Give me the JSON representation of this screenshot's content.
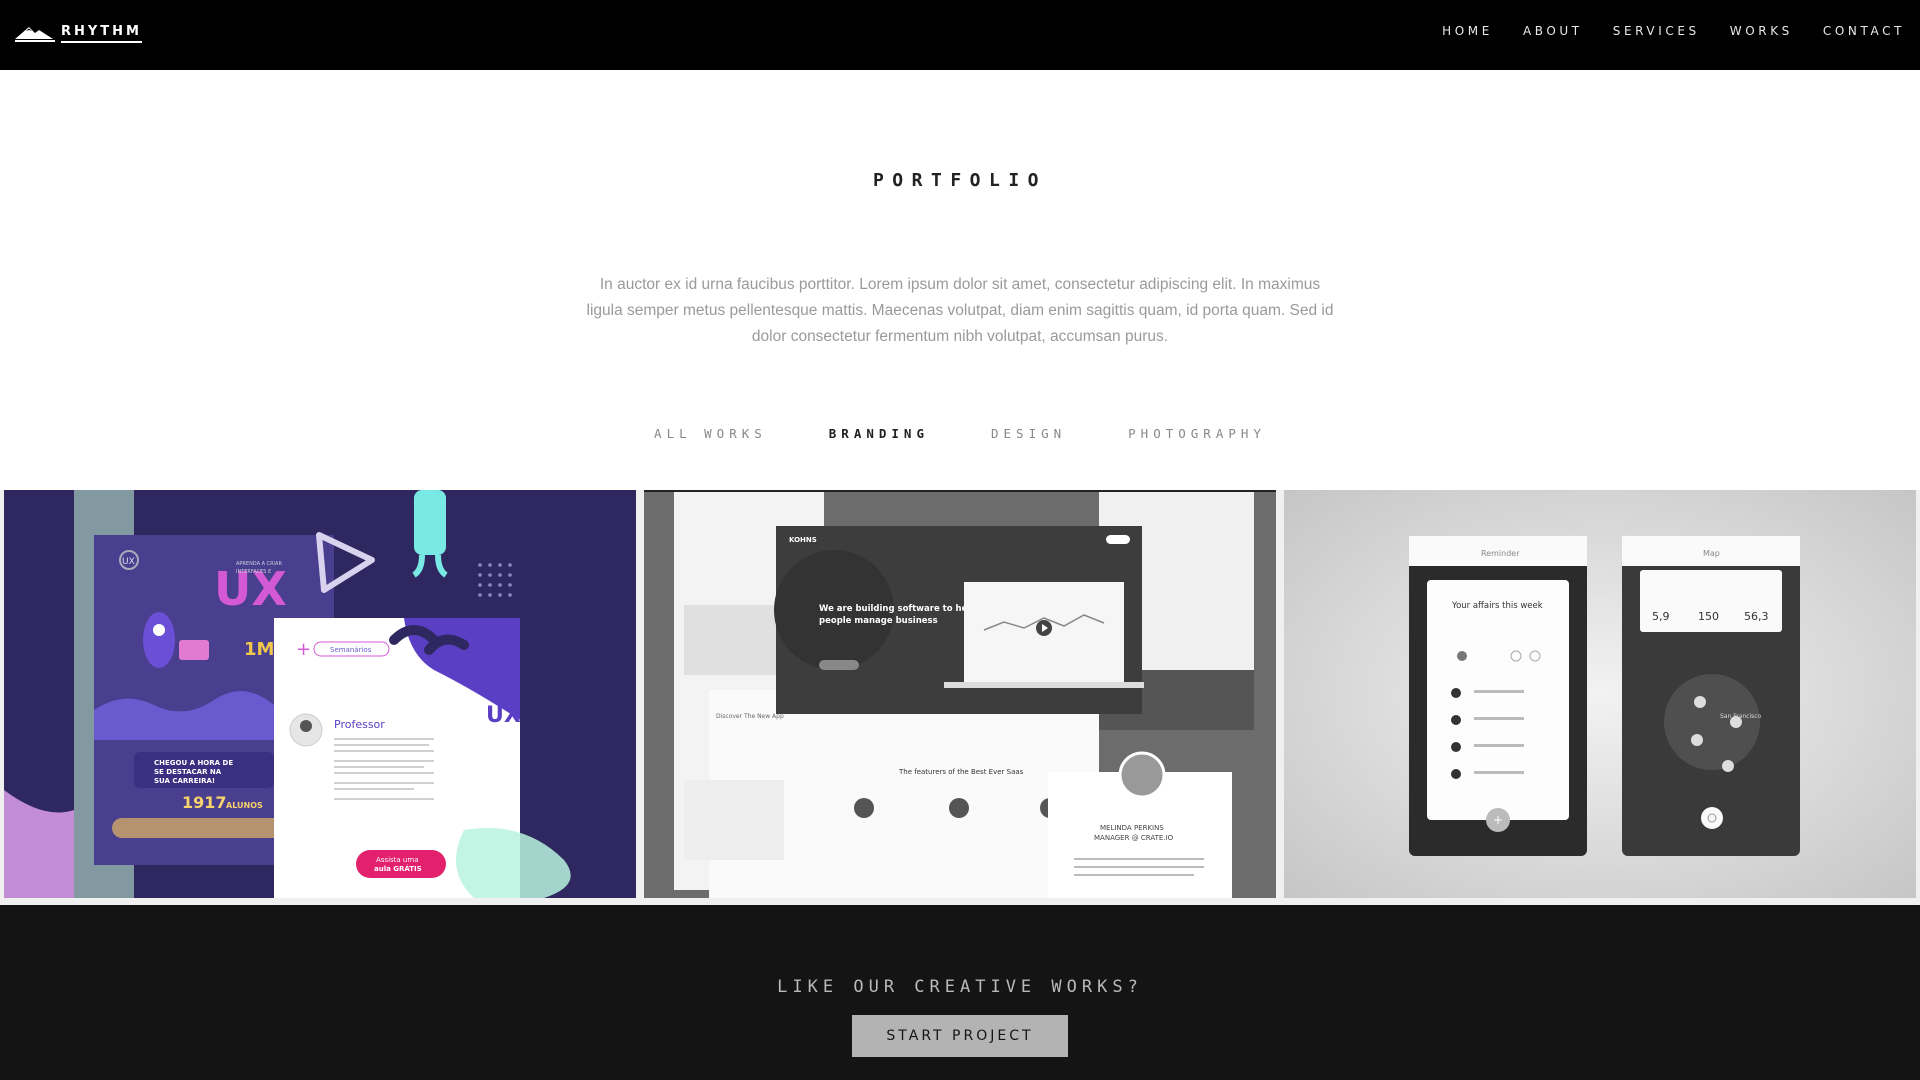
{
  "nav": {
    "brand": "RHYTHM",
    "items": [
      {
        "label": "HOME"
      },
      {
        "label": "ABOUT"
      },
      {
        "label": "SERVICES"
      },
      {
        "label": "WORKS"
      },
      {
        "label": "CONTACT"
      }
    ]
  },
  "portfolio": {
    "title": "PORTFOLIO",
    "intro": "In auctor ex id urna faucibus porttitor. Lorem ipsum dolor sit amet, consectetur adipiscing elit. In maximus ligula semper metus pellentesque mattis. Maecenas volutpat, diam enim sagittis quam, id porta quam. Sed id dolor consectetur fermentum nibh volutpat, accumsan purus.",
    "filters": [
      {
        "label": "ALL WORKS",
        "active": false
      },
      {
        "label": "BRANDING",
        "active": true
      },
      {
        "label": "DESIGN",
        "active": false
      },
      {
        "label": "PHOTOGRAPHY",
        "active": false
      }
    ],
    "works": [
      {
        "lines": [
          "UX",
          "APRENDA A CRIAR",
          "INTERFACES E",
          "1M",
          "Semanários",
          "Professor",
          "CHEGOU A HORA DE",
          "SE DESTACAR NA",
          "SUA CARREIRA!",
          "1917",
          "ALUNOS",
          "Assista uma",
          "aula GRÁTIS"
        ]
      },
      {
        "lines": [
          "KOHNS",
          "We are building software to help",
          "people manage business",
          "Discover The New App",
          "The featurers of the Best Ever Saas",
          "MELINDA PERKINS",
          "MANAGER @ CRATE.IO"
        ]
      },
      {
        "lines": [
          "Reminder",
          "Your affairs this week",
          "Map",
          "5,9",
          "150",
          "56,3",
          "San Francisco"
        ]
      }
    ]
  },
  "cta": {
    "text": "LIKE OUR CREATIVE WORKS?",
    "button": "START PROJECT"
  },
  "colors": {
    "nav_bg": "#000000",
    "cta_bg": "#141414",
    "button_bg": "#b3b3b3",
    "tile1_bg": "#2f2860",
    "tile1_accent_pink": "#e2206e",
    "tile1_accent_cyan": "#7ff5ee"
  }
}
